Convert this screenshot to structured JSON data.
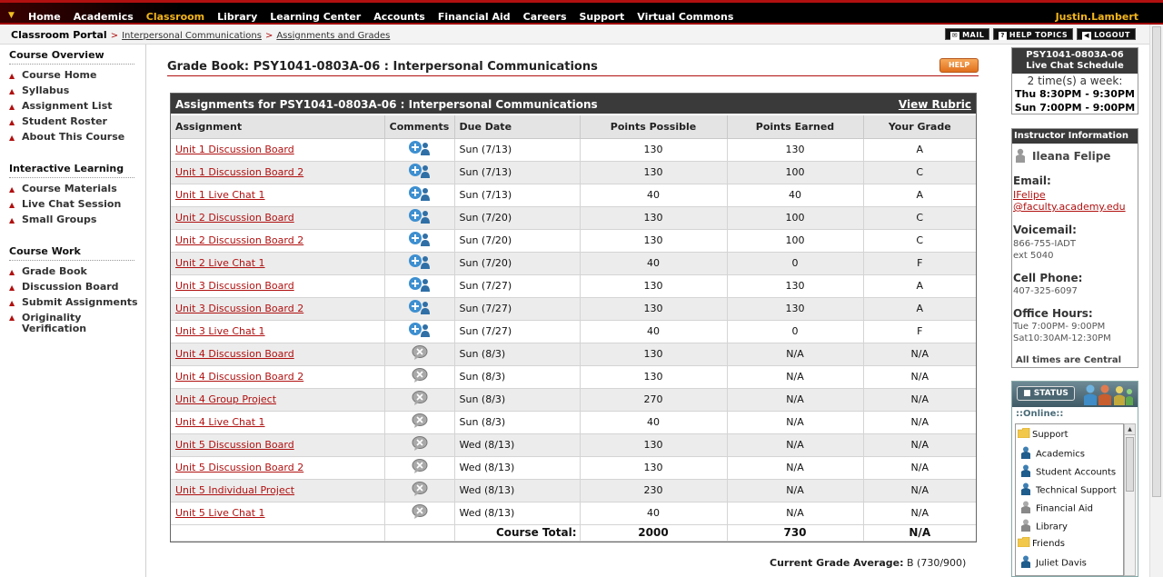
{
  "nav": {
    "items": [
      "Home",
      "Academics",
      "Classroom",
      "Library",
      "Learning Center",
      "Accounts",
      "Financial Aid",
      "Careers",
      "Support",
      "Virtual Commons"
    ],
    "active": "Classroom",
    "user": "Justin.Lambert"
  },
  "breadcrumb": {
    "root": "Classroom Portal",
    "course": "Interpersonal Communications",
    "page": "Assignments and Grades"
  },
  "toolbar": {
    "mail": "MAIL",
    "help_topics": "HELP TOPICS",
    "logout": "LOGOUT"
  },
  "sidebar": {
    "sections": [
      {
        "title": "Course Overview",
        "items": [
          "Course Home",
          "Syllabus",
          "Assignment List",
          "Student Roster",
          "About This Course"
        ]
      },
      {
        "title": "Interactive Learning",
        "items": [
          "Course Materials",
          "Live Chat Session",
          "Small Groups"
        ]
      },
      {
        "title": "Course Work",
        "items": [
          "Grade Book",
          "Discussion Board",
          "Submit Assignments",
          "Originality Verification"
        ]
      }
    ]
  },
  "main": {
    "title": "Grade Book: PSY1041-0803A-06 : Interpersonal Communications",
    "help": "HELP",
    "table_title": "Assignments for PSY1041-0803A-06 : Interpersonal Communications",
    "rubric": "View Rubric",
    "columns": [
      "Assignment",
      "Comments",
      "Due Date",
      "Points Possible",
      "Points Earned",
      "Your Grade"
    ],
    "rows": [
      {
        "name": "Unit 1 Discussion Board",
        "comment": true,
        "due": "Sun (7/13)",
        "possible": "130",
        "earned": "130",
        "grade": "A"
      },
      {
        "name": "Unit 1 Discussion Board 2",
        "comment": true,
        "due": "Sun (7/13)",
        "possible": "130",
        "earned": "100",
        "grade": "C"
      },
      {
        "name": "Unit 1 Live Chat 1",
        "comment": true,
        "due": "Sun (7/13)",
        "possible": "40",
        "earned": "40",
        "grade": "A"
      },
      {
        "name": "Unit 2 Discussion Board",
        "comment": true,
        "due": "Sun (7/20)",
        "possible": "130",
        "earned": "100",
        "grade": "C"
      },
      {
        "name": "Unit 2 Discussion Board 2",
        "comment": true,
        "due": "Sun (7/20)",
        "possible": "130",
        "earned": "100",
        "grade": "C"
      },
      {
        "name": "Unit 2 Live Chat 1",
        "comment": true,
        "due": "Sun (7/20)",
        "possible": "40",
        "earned": "0",
        "grade": "F"
      },
      {
        "name": "Unit 3 Discussion Board",
        "comment": true,
        "due": "Sun (7/27)",
        "possible": "130",
        "earned": "130",
        "grade": "A"
      },
      {
        "name": "Unit 3 Discussion Board 2",
        "comment": true,
        "due": "Sun (7/27)",
        "possible": "130",
        "earned": "130",
        "grade": "A"
      },
      {
        "name": "Unit 3 Live Chat 1",
        "comment": true,
        "due": "Sun (7/27)",
        "possible": "40",
        "earned": "0",
        "grade": "F"
      },
      {
        "name": "Unit 4 Discussion Board",
        "comment": false,
        "due": "Sun (8/3)",
        "possible": "130",
        "earned": "N/A",
        "grade": "N/A"
      },
      {
        "name": "Unit 4 Discussion Board 2",
        "comment": false,
        "due": "Sun (8/3)",
        "possible": "130",
        "earned": "N/A",
        "grade": "N/A"
      },
      {
        "name": "Unit 4 Group Project",
        "comment": false,
        "due": "Sun (8/3)",
        "possible": "270",
        "earned": "N/A",
        "grade": "N/A"
      },
      {
        "name": "Unit 4 Live Chat 1",
        "comment": false,
        "due": "Sun (8/3)",
        "possible": "40",
        "earned": "N/A",
        "grade": "N/A"
      },
      {
        "name": "Unit 5 Discussion Board",
        "comment": false,
        "due": "Wed (8/13)",
        "possible": "130",
        "earned": "N/A",
        "grade": "N/A"
      },
      {
        "name": "Unit 5 Discussion Board 2",
        "comment": false,
        "due": "Wed (8/13)",
        "possible": "130",
        "earned": "N/A",
        "grade": "N/A"
      },
      {
        "name": "Unit 5 Individual Project",
        "comment": false,
        "due": "Wed (8/13)",
        "possible": "230",
        "earned": "N/A",
        "grade": "N/A"
      },
      {
        "name": "Unit 5 Live Chat 1",
        "comment": false,
        "due": "Wed (8/13)",
        "possible": "40",
        "earned": "N/A",
        "grade": "N/A"
      }
    ],
    "total": {
      "label": "Course Total:",
      "possible": "2000",
      "earned": "730",
      "grade": "N/A"
    },
    "average": {
      "label": "Current Grade Average:",
      "value": "B (730/900)"
    }
  },
  "chat_schedule": {
    "title_line1": "PSY1041-0803A-06",
    "title_line2": "Live Chat Schedule",
    "frequency": "2 time(s) a week:",
    "slots": [
      "Thu 8:30PM - 9:30PM",
      "Sun 7:00PM - 9:00PM"
    ]
  },
  "instructor": {
    "header": "Instructor Information",
    "name": "Ileana Felipe",
    "email_label": "Email:",
    "email_line1": "IFelipe",
    "email_line2": "@faculty.academy.edu",
    "voicemail_label": "Voicemail:",
    "voicemail_line1": "866-755-IADT",
    "voicemail_line2": "ext 5040",
    "cell_label": "Cell Phone:",
    "cell": "407-325-6097",
    "office_label": "Office Hours:",
    "office_line1": "Tue  7:00PM-  9:00PM",
    "office_line2": "Sat10:30AM-12:30PM",
    "note": "All times are Central"
  },
  "status": {
    "button": "STATUS",
    "online_label": "::Online::",
    "entries": [
      {
        "label": "Support",
        "kind": "folder"
      },
      {
        "label": "Academics",
        "kind": "person"
      },
      {
        "label": "Student Accounts",
        "kind": "person"
      },
      {
        "label": "Technical Support",
        "kind": "person"
      },
      {
        "label": "Financial Aid",
        "kind": "person-gray"
      },
      {
        "label": "Library",
        "kind": "person-gray"
      },
      {
        "label": "Friends",
        "kind": "folder"
      },
      {
        "label": "Juliet Davis",
        "kind": "person"
      }
    ]
  },
  "colors": {
    "brand_red": "#b11010",
    "accent_gold": "#f3b51b",
    "header_dark": "#3a3a3a"
  }
}
